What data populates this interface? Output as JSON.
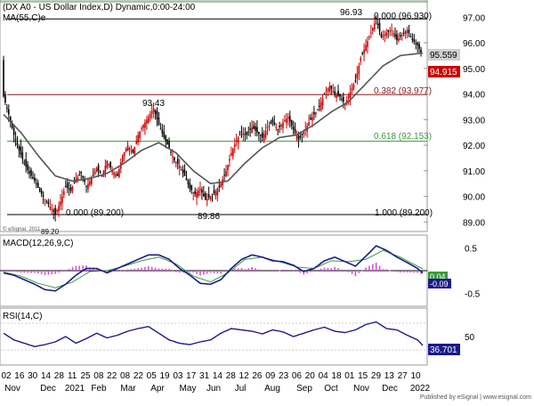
{
  "header": {
    "symbol_line": "(DX A0 - US Dollar Index,D) Dynamic,0:00-24:00",
    "ma_label": "MA(55,C)e",
    "copyright": "© eSignal, 2011",
    "footer": "Published by eSignal | www.esignal.com"
  },
  "colors": {
    "bull": "#cc0000",
    "bear": "#000000",
    "ma": "#555555",
    "macd": "#1a1a8c",
    "signal": "#3a9a3a",
    "hist": "#d94fd9",
    "rsi": "#1a1a8c",
    "fib_top": "#000000",
    "fib_382": "#8b1a1a",
    "fib_618": "#3a9a3a",
    "last_price_bg": "#cc0000",
    "ma_value_bg": "#d0d0d0",
    "macd_value_bg": "#3a9a3a",
    "rsi_value_bg": "#1a1a8c"
  },
  "chart_data": [
    {
      "type": "candlestick",
      "title": "(DX A0 - US Dollar Index,D) Dynamic,0:00-24:00",
      "ylim": [
        88.7,
        97.6
      ],
      "y_ticks": [
        "97.00",
        "96.00",
        "95.00",
        "94.00",
        "93.00",
        "92.00",
        "91.00",
        "90.00",
        "89.00"
      ],
      "x_labels_top": [
        "02",
        "16",
        "30",
        "14",
        "28",
        "11",
        "25",
        "08",
        "22",
        "08",
        "22",
        "05",
        "19",
        "03",
        "17",
        "31",
        "14",
        "28",
        "12",
        "26",
        "09",
        "23",
        "06",
        "20",
        "04",
        "18",
        "01",
        "15",
        "29",
        "13",
        "27",
        "10"
      ],
      "x_labels_month": [
        "Nov",
        "Dec",
        "2021",
        "Feb",
        "Mar",
        "Apr",
        "May",
        "Jun",
        "Jul",
        "Aug",
        "Sep",
        "Oct",
        "Nov",
        "Dec",
        "2022"
      ],
      "close_path": [
        [
          0,
          93.9
        ],
        [
          3,
          93.2
        ],
        [
          6,
          92.4
        ],
        [
          9,
          91.8
        ],
        [
          12,
          91.3
        ],
        [
          15,
          90.9
        ],
        [
          18,
          90.6
        ],
        [
          21,
          90.2
        ],
        [
          24,
          89.9
        ],
        [
          27,
          89.6
        ],
        [
          30,
          89.3
        ],
        [
          33,
          89.8
        ],
        [
          36,
          90.4
        ],
        [
          39,
          90.2
        ],
        [
          42,
          90.7
        ],
        [
          45,
          90.9
        ],
        [
          48,
          90.4
        ],
        [
          51,
          90.7
        ],
        [
          54,
          91.1
        ],
        [
          57,
          90.8
        ],
        [
          60,
          91.4
        ],
        [
          63,
          91.0
        ],
        [
          66,
          90.8
        ],
        [
          69,
          91.6
        ],
        [
          72,
          92.0
        ],
        [
          75,
          91.7
        ],
        [
          78,
          92.4
        ],
        [
          81,
          92.8
        ],
        [
          84,
          93.1
        ],
        [
          87,
          93.43
        ],
        [
          90,
          92.8
        ],
        [
          93,
          92.3
        ],
        [
          96,
          91.9
        ],
        [
          99,
          91.4
        ],
        [
          102,
          91.2
        ],
        [
          105,
          90.8
        ],
        [
          108,
          90.3
        ],
        [
          111,
          90.1
        ],
        [
          114,
          90.3
        ],
        [
          117,
          89.86
        ],
        [
          120,
          90.0
        ],
        [
          123,
          90.2
        ],
        [
          126,
          90.5
        ],
        [
          129,
          91.0
        ],
        [
          132,
          91.7
        ],
        [
          135,
          92.2
        ],
        [
          138,
          92.5
        ],
        [
          141,
          92.4
        ],
        [
          144,
          92.7
        ],
        [
          147,
          92.5
        ],
        [
          150,
          92.3
        ],
        [
          153,
          92.7
        ],
        [
          156,
          92.9
        ],
        [
          159,
          92.6
        ],
        [
          162,
          92.9
        ],
        [
          165,
          93.1
        ],
        [
          168,
          92.6
        ],
        [
          171,
          92.2
        ],
        [
          174,
          92.5
        ],
        [
          177,
          92.9
        ],
        [
          180,
          93.2
        ],
        [
          183,
          93.5
        ],
        [
          186,
          94.0
        ],
        [
          189,
          94.3
        ],
        [
          192,
          94.0
        ],
        [
          195,
          93.9
        ],
        [
          198,
          93.6
        ],
        [
          201,
          94.1
        ],
        [
          204,
          94.5
        ],
        [
          207,
          95.4
        ],
        [
          210,
          95.9
        ],
        [
          213,
          96.4
        ],
        [
          216,
          96.93
        ],
        [
          219,
          96.2
        ],
        [
          222,
          96.4
        ],
        [
          225,
          96.5
        ],
        [
          228,
          96.1
        ],
        [
          231,
          96.3
        ],
        [
          234,
          96.5
        ],
        [
          237,
          96.1
        ],
        [
          240,
          95.9
        ],
        [
          243,
          95.5
        ]
      ],
      "ma_path": [
        [
          0,
          93.2
        ],
        [
          10,
          92.5
        ],
        [
          20,
          91.6
        ],
        [
          30,
          90.8
        ],
        [
          40,
          90.6
        ],
        [
          50,
          90.7
        ],
        [
          60,
          90.9
        ],
        [
          70,
          91.3
        ],
        [
          80,
          91.8
        ],
        [
          90,
          92.1
        ],
        [
          100,
          91.7
        ],
        [
          110,
          91.0
        ],
        [
          120,
          90.5
        ],
        [
          130,
          90.6
        ],
        [
          140,
          91.3
        ],
        [
          150,
          91.9
        ],
        [
          160,
          92.3
        ],
        [
          170,
          92.4
        ],
        [
          180,
          92.8
        ],
        [
          190,
          93.3
        ],
        [
          200,
          93.7
        ],
        [
          210,
          94.4
        ],
        [
          220,
          95.1
        ],
        [
          230,
          95.5
        ],
        [
          243,
          95.6
        ]
      ],
      "fib_levels": [
        {
          "label": "0.000 (96.930)",
          "value": 96.93
        },
        {
          "label": "0.382 (93.977)",
          "value": 93.977
        },
        {
          "label": "0.618 (92.153)",
          "value": 92.153
        }
      ],
      "peak_labels": [
        {
          "text": "96.93",
          "x": 216,
          "y": 96.93
        },
        {
          "text": "93.43",
          "x": 87,
          "y": 93.43
        },
        {
          "text": "89.86",
          "x": 117,
          "y": 89.86
        }
      ],
      "extra_labels": [
        {
          "text": "0.000 (89.200)"
        },
        {
          "text": "1.000 (89.200)"
        },
        {
          "text": "89.20"
        }
      ],
      "current_values": {
        "ma": "95.559",
        "last": "94.915"
      }
    },
    {
      "type": "line",
      "title": "MACD(12,26,9,C)",
      "ylim": [
        -0.75,
        0.75
      ],
      "y_ticks": [
        "0.5",
        "-0.5"
      ],
      "macd_path": [
        [
          0,
          -0.05
        ],
        [
          6,
          -0.1
        ],
        [
          12,
          -0.2
        ],
        [
          18,
          -0.3
        ],
        [
          24,
          -0.42
        ],
        [
          30,
          -0.45
        ],
        [
          36,
          -0.3
        ],
        [
          42,
          -0.1
        ],
        [
          48,
          0.05
        ],
        [
          54,
          0.05
        ],
        [
          60,
          -0.05
        ],
        [
          66,
          0.05
        ],
        [
          72,
          0.15
        ],
        [
          78,
          0.25
        ],
        [
          84,
          0.35
        ],
        [
          90,
          0.35
        ],
        [
          96,
          0.25
        ],
        [
          102,
          0.05
        ],
        [
          108,
          -0.1
        ],
        [
          114,
          -0.28
        ],
        [
          120,
          -0.3
        ],
        [
          126,
          -0.2
        ],
        [
          132,
          0.05
        ],
        [
          138,
          0.25
        ],
        [
          144,
          0.35
        ],
        [
          150,
          0.3
        ],
        [
          156,
          0.22
        ],
        [
          162,
          0.2
        ],
        [
          168,
          0.12
        ],
        [
          174,
          -0.02
        ],
        [
          180,
          0.05
        ],
        [
          186,
          0.22
        ],
        [
          192,
          0.3
        ],
        [
          198,
          0.2
        ],
        [
          204,
          0.1
        ],
        [
          210,
          0.32
        ],
        [
          216,
          0.55
        ],
        [
          222,
          0.45
        ],
        [
          228,
          0.3
        ],
        [
          234,
          0.18
        ],
        [
          240,
          0.05
        ],
        [
          243,
          -0.05
        ]
      ],
      "signal_path": [
        [
          0,
          -0.03
        ],
        [
          10,
          -0.12
        ],
        [
          20,
          -0.28
        ],
        [
          30,
          -0.38
        ],
        [
          40,
          -0.25
        ],
        [
          50,
          -0.02
        ],
        [
          60,
          0.0
        ],
        [
          70,
          0.1
        ],
        [
          80,
          0.22
        ],
        [
          90,
          0.3
        ],
        [
          100,
          0.15
        ],
        [
          110,
          -0.12
        ],
        [
          120,
          -0.25
        ],
        [
          130,
          -0.05
        ],
        [
          140,
          0.25
        ],
        [
          150,
          0.3
        ],
        [
          160,
          0.2
        ],
        [
          170,
          0.08
        ],
        [
          180,
          0.05
        ],
        [
          190,
          0.22
        ],
        [
          200,
          0.2
        ],
        [
          210,
          0.25
        ],
        [
          220,
          0.45
        ],
        [
          230,
          0.3
        ],
        [
          243,
          0.04
        ]
      ],
      "current_values": {
        "signal": "0.04",
        "macd": "-0.09"
      }
    },
    {
      "type": "line",
      "title": "RSI(14,C)",
      "ylim": [
        10,
        90
      ],
      "y_ticks": [
        "50"
      ],
      "rsi_path": [
        [
          0,
          55
        ],
        [
          6,
          45
        ],
        [
          12,
          40
        ],
        [
          18,
          35
        ],
        [
          24,
          38
        ],
        [
          30,
          42
        ],
        [
          36,
          50
        ],
        [
          42,
          40
        ],
        [
          48,
          47
        ],
        [
          54,
          55
        ],
        [
          60,
          48
        ],
        [
          66,
          52
        ],
        [
          72,
          58
        ],
        [
          78,
          62
        ],
        [
          84,
          65
        ],
        [
          90,
          55
        ],
        [
          96,
          45
        ],
        [
          102,
          40
        ],
        [
          108,
          38
        ],
        [
          114,
          42
        ],
        [
          120,
          45
        ],
        [
          126,
          55
        ],
        [
          132,
          62
        ],
        [
          138,
          60
        ],
        [
          144,
          58
        ],
        [
          150,
          54
        ],
        [
          156,
          60
        ],
        [
          162,
          57
        ],
        [
          168,
          50
        ],
        [
          174,
          55
        ],
        [
          180,
          60
        ],
        [
          186,
          64
        ],
        [
          192,
          58
        ],
        [
          198,
          56
        ],
        [
          204,
          60
        ],
        [
          210,
          68
        ],
        [
          216,
          72
        ],
        [
          222,
          62
        ],
        [
          228,
          60
        ],
        [
          234,
          52
        ],
        [
          240,
          45
        ],
        [
          243,
          36.7
        ]
      ],
      "current_values": {
        "rsi": "36.701"
      }
    }
  ]
}
